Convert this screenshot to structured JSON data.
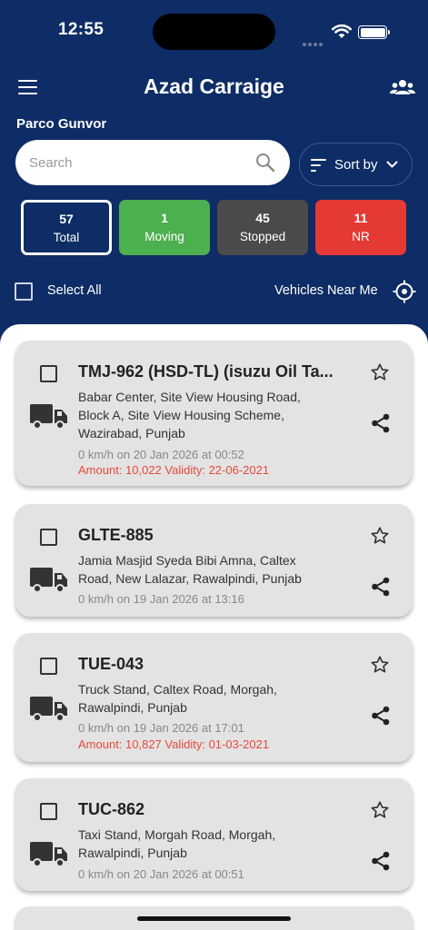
{
  "status_bar": {
    "time": "12:55"
  },
  "app": {
    "title": "Azad Carraige"
  },
  "account": {
    "name": "Parco Gunvor"
  },
  "search": {
    "placeholder": "Search",
    "value": ""
  },
  "sort": {
    "label": "Sort by"
  },
  "stats": [
    {
      "count": "57",
      "label": "Total",
      "color": "#0e2c65"
    },
    {
      "count": "1",
      "label": "Moving",
      "color": "#4caf50"
    },
    {
      "count": "45",
      "label": "Stopped",
      "color": "#4a4a4a"
    },
    {
      "count": "11",
      "label": "NR",
      "color": "#e53935"
    }
  ],
  "controls": {
    "select_all": "Select All",
    "near_me": "Vehicles Near Me"
  },
  "colors": {
    "header_bg": "#0e2c65",
    "card_bg": "#e3e3e3",
    "alert_text": "#e64a3b"
  },
  "vehicles": [
    {
      "title": "TMJ-962 (HSD-TL) (isuzu Oil Ta...",
      "address": "Babar Center, Site View Housing Road, Block A, Site View Housing Scheme, Wazirabad, Punjab",
      "speed": "0 km/h on 20 Jan 2026 at 00:52",
      "amount": "Amount: 10,022 Validity: 22-06-2021"
    },
    {
      "title": "GLTE-885",
      "address": "Jamia Masjid Syeda Bibi Amna, Caltex Road, New Lalazar, Rawalpindi, Punjab",
      "speed": "0 km/h on 19 Jan 2026 at 13:16"
    },
    {
      "title": "TUE-043",
      "address": "Truck Stand, Caltex Road, Morgah, Rawalpindi, Punjab",
      "speed": "0 km/h on 19 Jan 2026 at 17:01",
      "amount": "Amount: 10,827 Validity: 01-03-2021"
    },
    {
      "title": "TUC-862",
      "address": "Taxi Stand, Morgah Road, Morgah, Rawalpindi, Punjab",
      "speed": "0 km/h on 20 Jan 2026 at 00:51"
    }
  ]
}
